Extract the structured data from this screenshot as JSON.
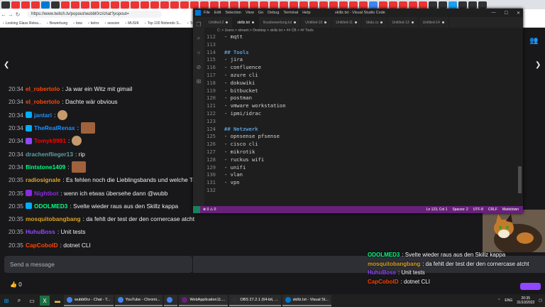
{
  "browser": {
    "url": "https://www.twitch.tv/popout/wubbl0rz/chat?popout=",
    "bookmarks": [
      "Looking Glass Relea...",
      "Bewerbung",
      "bsw",
      "belnx",
      "session",
      "MUSIK",
      "Top 100 Nintendo S...",
      "Top 10"
    ]
  },
  "chat": {
    "messages": [
      {
        "time": "20:34",
        "user": "el_robertolo",
        "color": "#ff4500",
        "text": ": Ja war ein Witz mit gimail"
      },
      {
        "time": "20:34",
        "user": "el_robertolo",
        "color": "#ff4500",
        "text": ": Dachte wär obvious"
      },
      {
        "time": "20:34",
        "user": "jantari",
        "color": "#1e90ff",
        "text": ":",
        "emote": true
      },
      {
        "time": "20:34",
        "user": "TheRealRenax",
        "color": "#1e90ff",
        "text": ":",
        "emote_big": true
      },
      {
        "time": "20:34",
        "user": "Tomyk9991",
        "color": "#ff0000",
        "text": ":",
        "emote": true
      },
      {
        "time": "20:34",
        "user": "drachenflieger13",
        "color": "#5f9ea0",
        "text": ": rip"
      },
      {
        "time": "20:34",
        "user": "flintstone1409",
        "color": "#00ff7f",
        "text": ":",
        "emote_big": true
      },
      {
        "time": "20:35",
        "user": "radiosignale",
        "color": "#daa520",
        "text": ": Es fehlen noch die Lieblingsbands und welche Te"
      },
      {
        "time": "20:35",
        "user": "Nightbot",
        "color": "#8a2be2",
        "text": ": wenn ich etwas übersehe dann @wubb"
      },
      {
        "time": "20:35",
        "user": "ODOLMED3",
        "color": "#00ff7f",
        "text": ": Svelte wieder raus aus den Skillz kappa"
      },
      {
        "time": "20:35",
        "user": "mosquitobangbang",
        "color": "#daa520",
        "text": ": da fehlt der test der den cornercase atcht"
      },
      {
        "time": "20:35",
        "user": "HuhuBoss",
        "color": "#9147ff",
        "text": ": Unit tests"
      },
      {
        "time": "20:35",
        "user": "CapCobolD",
        "color": "#ff4500",
        "text": ": dotnet CLI"
      }
    ],
    "send_placeholder": "Send a message",
    "points": "0"
  },
  "overlay": {
    "messages": [
      {
        "user": "ODOLMED3",
        "color": "#00ff7f",
        "text": ": Svelte wieder raus aus den Skillz kappa"
      },
      {
        "user": "mosquitobangbang",
        "color": "#daa520",
        "text": ": da fehlt der test der den cornercase atcht"
      },
      {
        "user": "HuhuBoss",
        "color": "#9147ff",
        "text": ": Unit tests"
      },
      {
        "user": "CapCobolD",
        "color": "#ff4500",
        "text": ": dotnet CLI"
      }
    ]
  },
  "vscode": {
    "title": "skillz.txt - Visual Studio Code",
    "menu": [
      "File",
      "Edit",
      "Selection",
      "View",
      "Go",
      "Debug",
      "Terminal",
      "Help"
    ],
    "tabs": [
      {
        "label": "Untitled-2",
        "active": false
      },
      {
        "label": "skillz.txt",
        "active": true
      },
      {
        "label": "linuxbewertung.txt",
        "active": false
      },
      {
        "label": "Untitled-10",
        "active": false
      },
      {
        "label": "Untitled-11",
        "active": false
      },
      {
        "label": "bkdu.cs",
        "active": false
      },
      {
        "label": "Untitled-13",
        "active": false
      },
      {
        "label": "Untitled-14",
        "active": false
      }
    ],
    "breadcrumb": "C: > Users > stream > Desktop > skillz.txt > ## CB > ## Tools",
    "lines": [
      {
        "n": "112",
        "text": "- mqtt",
        "heading": false
      },
      {
        "n": "113",
        "text": "",
        "heading": false
      },
      {
        "n": "114",
        "text": "## Tools",
        "heading": true
      },
      {
        "n": "115",
        "text": "- jira",
        "heading": false
      },
      {
        "n": "116",
        "text": "- confluence",
        "heading": false
      },
      {
        "n": "117",
        "text": "- azure cli",
        "heading": false
      },
      {
        "n": "118",
        "text": "- dokuwiki",
        "heading": false
      },
      {
        "n": "119",
        "text": "- bitbucket",
        "heading": false
      },
      {
        "n": "120",
        "text": "- postman",
        "heading": false
      },
      {
        "n": "121",
        "text": "- vmware workstation",
        "heading": false
      },
      {
        "n": "122",
        "text": "- ipmi/idrac",
        "heading": false
      },
      {
        "n": "123",
        "text": "",
        "heading": false
      },
      {
        "n": "124",
        "text": "## Netzwerk",
        "heading": true
      },
      {
        "n": "125",
        "text": "- opnsense pfsense",
        "heading": false
      },
      {
        "n": "126",
        "text": "- cisco cli",
        "heading": false
      },
      {
        "n": "127",
        "text": "- mikrotik",
        "heading": false
      },
      {
        "n": "128",
        "text": "- ruckus wifi",
        "heading": false
      },
      {
        "n": "129",
        "text": "- unifi",
        "heading": false
      },
      {
        "n": "130",
        "text": "- vlan",
        "heading": false
      },
      {
        "n": "131",
        "text": "- vpn",
        "heading": false
      },
      {
        "n": "132",
        "text": "",
        "heading": false
      }
    ],
    "status": {
      "errors": "⊗ 0 ⚠ 0",
      "position": "Ln 123, Col 1",
      "spaces": "Spaces: 2",
      "encoding": "UTF-8",
      "eol": "CRLF",
      "language": "Markdown"
    }
  },
  "taskbar": {
    "apps": [
      {
        "label": "wubbl0rz - Chat - T...",
        "color": "#4285f4"
      },
      {
        "label": "YouTube - Chromi...",
        "color": "#4285f4"
      },
      {
        "label": "",
        "color": "#4285f4"
      },
      {
        "label": "WebApplication11....",
        "color": "#68217a"
      },
      {
        "label": "OBS 27.2.1 (64-bit, ...",
        "color": "#302e31"
      },
      {
        "label": "skillz.txt - Visual St...",
        "color": "#0078d4"
      }
    ],
    "lang": "ENG",
    "time": "20:35",
    "date": "31/10/2022"
  }
}
